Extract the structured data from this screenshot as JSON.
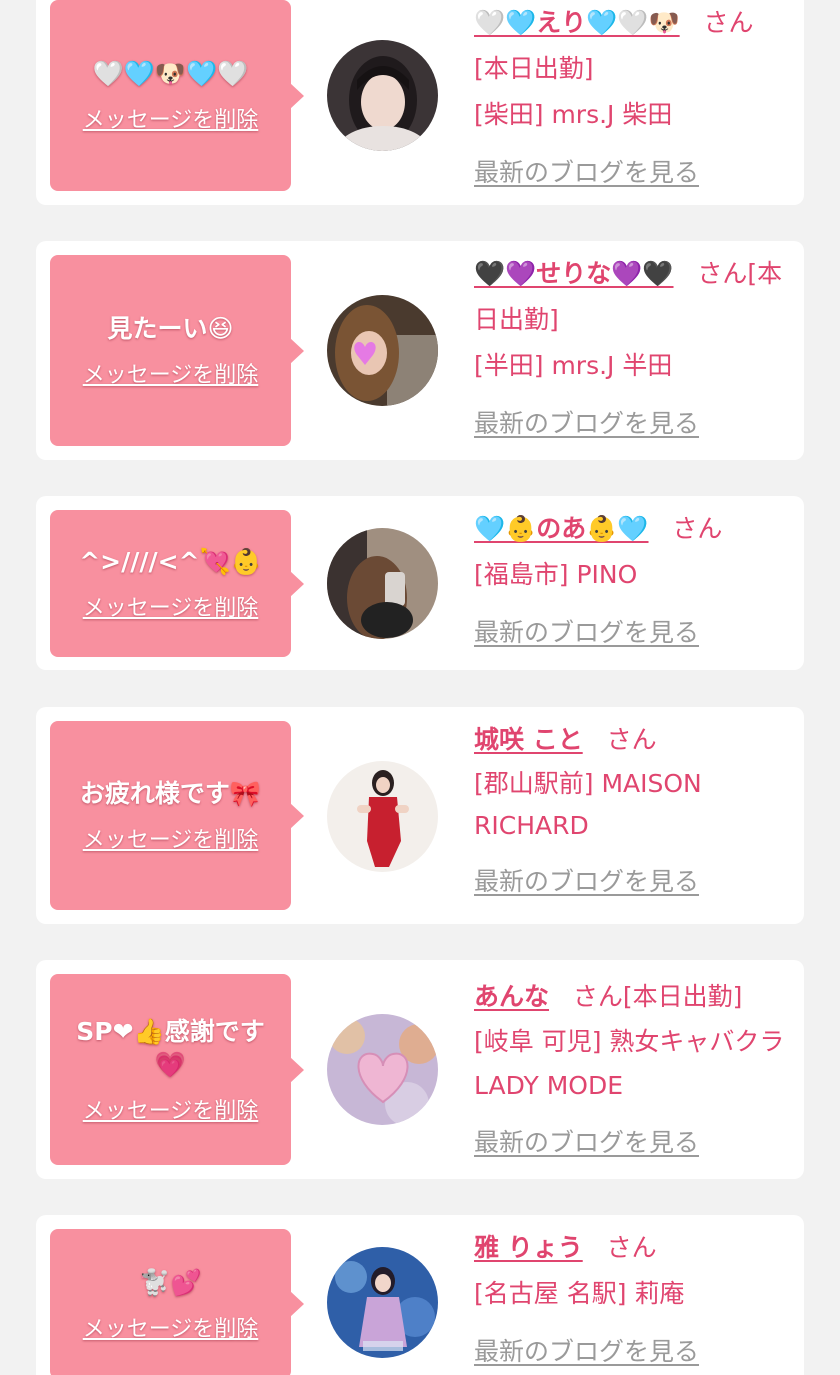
{
  "san_suffix": "さん",
  "delete_label": "メッセージを削除",
  "blog_label": "最新のブログを見る",
  "colors": {
    "accent": "#e0456f",
    "bubble": "#f8909f",
    "muted": "#9a9a9a",
    "background": "#f2f2f2"
  },
  "messages": [
    {
      "bubble_text": "🤍🩵🐶🩵🤍",
      "name": "🤍🩵えり🩵🤍🐶",
      "status": "[本日出勤]",
      "shop": "[柴田] mrs.J 柴田",
      "avatar_icon": "woman-portrait-icon"
    },
    {
      "bubble_text": "見たーい😆",
      "name": "🖤💜せりな💜🖤",
      "status": "[本日出勤]",
      "shop": "[半田] mrs.J 半田",
      "avatar_icon": "woman-heart-sticker-icon"
    },
    {
      "bubble_text": "^>////<^💘👶",
      "name": "🩵👶のあ👶🩵",
      "status": "",
      "shop": "[福島市] PINO",
      "avatar_icon": "woman-mirror-selfie-icon"
    },
    {
      "bubble_text": "お疲れ様です🎀",
      "name": "城咲 こと",
      "status": "",
      "shop": "[郡山駅前] MAISON RICHARD",
      "avatar_icon": "woman-red-dress-icon"
    },
    {
      "bubble_text": "SP❤👍感謝です💗",
      "name": "あんな",
      "status": "[本日出勤]",
      "shop": "[岐阜 可児] 熟女キャバクラ LADY MODE",
      "avatar_icon": "pink-heart-bokeh-icon"
    },
    {
      "bubble_text": "🐩💕",
      "name": "雅 りょう",
      "status": "",
      "shop": "[名古屋 名駅] 莉庵",
      "avatar_icon": "woman-blue-fantasy-icon"
    }
  ]
}
